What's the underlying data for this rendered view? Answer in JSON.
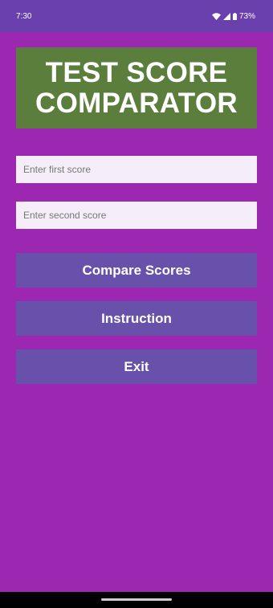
{
  "status_bar": {
    "time": "7:30",
    "battery": "73%",
    "icons": [
      "wifi-icon",
      "signal-icon",
      "battery-icon"
    ]
  },
  "title": "TEST SCORE\nCOMPARATOR",
  "inputs": {
    "first_score": {
      "value": "",
      "placeholder": "Enter first score"
    },
    "second_score": {
      "value": "",
      "placeholder": "Enter second score"
    }
  },
  "buttons": {
    "compare": "Compare Scores",
    "instruction": "Instruction",
    "exit": "Exit"
  },
  "colors": {
    "background": "#9c27b0",
    "status_bar": "#6a3fae",
    "title_bg": "#5b7e3c",
    "button_bg": "#6751aa",
    "input_bg": "#f5eef8"
  }
}
